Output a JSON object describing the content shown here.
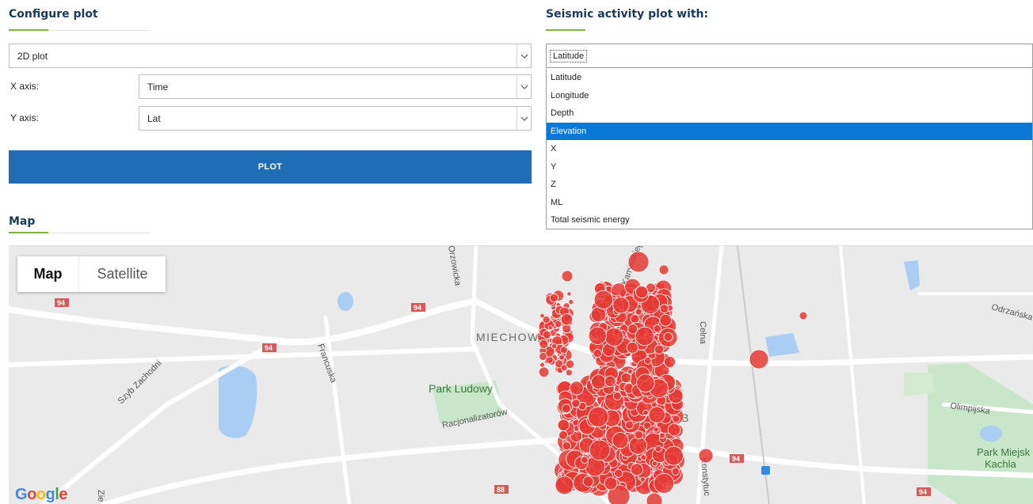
{
  "configure": {
    "title": "Configure plot",
    "plot_type": "2D plot",
    "x_label": "X axis:",
    "x_value": "Time",
    "y_label": "Y axis:",
    "y_value": "Lat",
    "plot_button": "PLOT"
  },
  "seismic": {
    "title": "Seismic activity plot with:",
    "selected": "Latitude",
    "options": [
      "Latitude",
      "Longitude",
      "Depth",
      "Elevation",
      "X",
      "Y",
      "Z",
      "ML",
      "Total seismic energy"
    ],
    "highlighted": "Elevation"
  },
  "map_section": {
    "title": "Map",
    "toggle_map": "Map",
    "toggle_satellite": "Satellite",
    "attribution": "Google",
    "labels": {
      "district": "MIECHOWIC",
      "park": "Park Ludowy",
      "park2_line1": "Park Miejsk",
      "park2_line2": "Kachla",
      "street_francuska": "Francuska",
      "street_szyb": "Szyb Zachodni",
      "street_racjonal": "Racjonalizatorów",
      "street_celna": "Celna",
      "street_odrzanska": "Odrzańska",
      "street_olimpijska": "Olimpijska",
      "street_orzowicka": "Orzowicka",
      "street_konstytucji": "Konstytuc",
      "street_kaminskiego": "Kamińskiego",
      "street_zie": "Zie",
      "fragment_rb": "RB"
    },
    "road_badges": [
      "94",
      "94",
      "94",
      "94",
      "94",
      "88"
    ]
  },
  "colors": {
    "accent": "#1f6db5",
    "highlight": "#0a78d7",
    "quake_fill": "#e53935",
    "title_rule": "#7cb342"
  }
}
